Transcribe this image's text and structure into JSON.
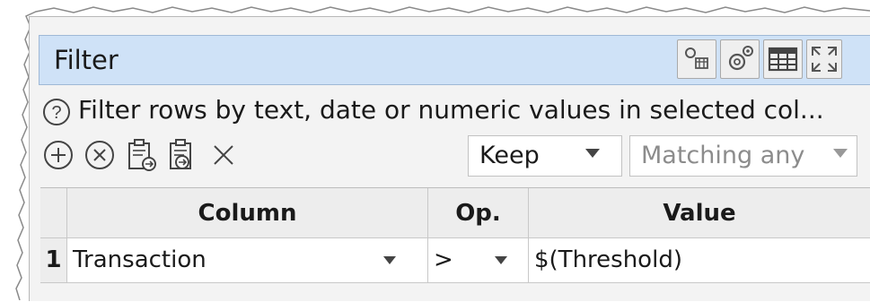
{
  "panel": {
    "title": "Filter",
    "toolbar_icons": [
      "link-settings-icon",
      "gear-icon",
      "table-icon",
      "expand-icon"
    ]
  },
  "description": "Filter rows by text, date or numeric values in selected col...",
  "actions": {
    "icons": [
      "add-icon",
      "remove-icon",
      "paste-into-icon",
      "paste-replace-icon",
      "clear-icon"
    ],
    "keep_select": "Keep",
    "matching_select": "Matching any"
  },
  "table": {
    "headers": [
      "",
      "Column",
      "Op.",
      "Value"
    ],
    "rows": [
      {
        "num": "1",
        "column": "Transaction",
        "op": ">",
        "value": "$(Threshold)"
      }
    ]
  }
}
